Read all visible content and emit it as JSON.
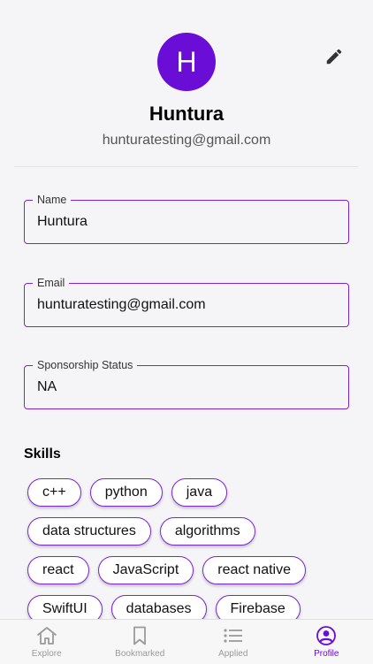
{
  "profile": {
    "avatar_initial": "H",
    "name": "Huntura",
    "email": "hunturatesting@gmail.com",
    "edit_icon": "pencil-icon"
  },
  "fields": [
    {
      "label": "Name",
      "value": "Huntura"
    },
    {
      "label": "Email",
      "value": "hunturatesting@gmail.com"
    },
    {
      "label": "Sponsorship Status",
      "value": "NA"
    }
  ],
  "skills": {
    "title": "Skills",
    "rows": [
      [
        "c++",
        "python",
        "java"
      ],
      [
        "data structures",
        "algorithms"
      ],
      [
        "react",
        "JavaScript",
        "react native"
      ],
      [
        "SwiftUI",
        "databases",
        "Firebase"
      ]
    ]
  },
  "tabs": [
    {
      "label": "Explore",
      "icon": "home-icon"
    },
    {
      "label": "Bookmarked",
      "icon": "bookmark-icon"
    },
    {
      "label": "Applied",
      "icon": "list-icon"
    },
    {
      "label": "Profile",
      "icon": "profile-icon",
      "active": true
    }
  ],
  "colors": {
    "accent": "#6a0dd6",
    "border": "#7b25d8",
    "background": "#f5f5f7",
    "inactive_tab": "#9a9a9a"
  }
}
